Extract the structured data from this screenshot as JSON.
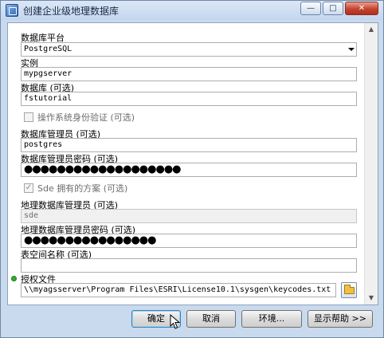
{
  "window": {
    "title": "创建企业级地理数据库",
    "min_glyph": "—",
    "max_glyph": "□",
    "close_glyph": "✕"
  },
  "form": {
    "platform": {
      "label": "数据库平台",
      "value": "PostgreSQL"
    },
    "instance": {
      "label": "实例",
      "value": "mypgserver"
    },
    "database": {
      "label": "数据库 (可选)",
      "value": "fstutorial"
    },
    "os_auth": {
      "label": "操作系统身份验证 (可选)",
      "checked": false
    },
    "db_admin": {
      "label": "数据库管理员 (可选)",
      "value": "postgres"
    },
    "db_admin_password": {
      "label": "数据库管理员密码 (可选)",
      "value": "●●●●●●●●●●●●●●●●●●●"
    },
    "sde_schema": {
      "label": "Sde 拥有的方案 (可选)",
      "checked": true,
      "check_glyph": "✓"
    },
    "gdb_admin": {
      "label": "地理数据库管理员 (可选)",
      "value": "sde"
    },
    "gdb_admin_password": {
      "label": "地理数据库管理员密码 (可选)",
      "value": "●●●●●●●●●●●●●●●●"
    },
    "tablespace": {
      "label": "表空间名称 (可选)",
      "value": ""
    },
    "auth_file": {
      "label": "授权文件",
      "value": "\\\\myagsserver\\Program Files\\ESRI\\License10.1\\sysgen\\keycodes.txt"
    }
  },
  "scrollbar": {
    "up_glyph": "▲",
    "down_glyph": "▼"
  },
  "buttons": {
    "ok": "确定",
    "cancel": "取消",
    "environments": "环境...",
    "show_help": "显示帮助 >>"
  },
  "colors": {
    "required_indicator": "#30b030",
    "dialog_bg": "#c9daee"
  }
}
